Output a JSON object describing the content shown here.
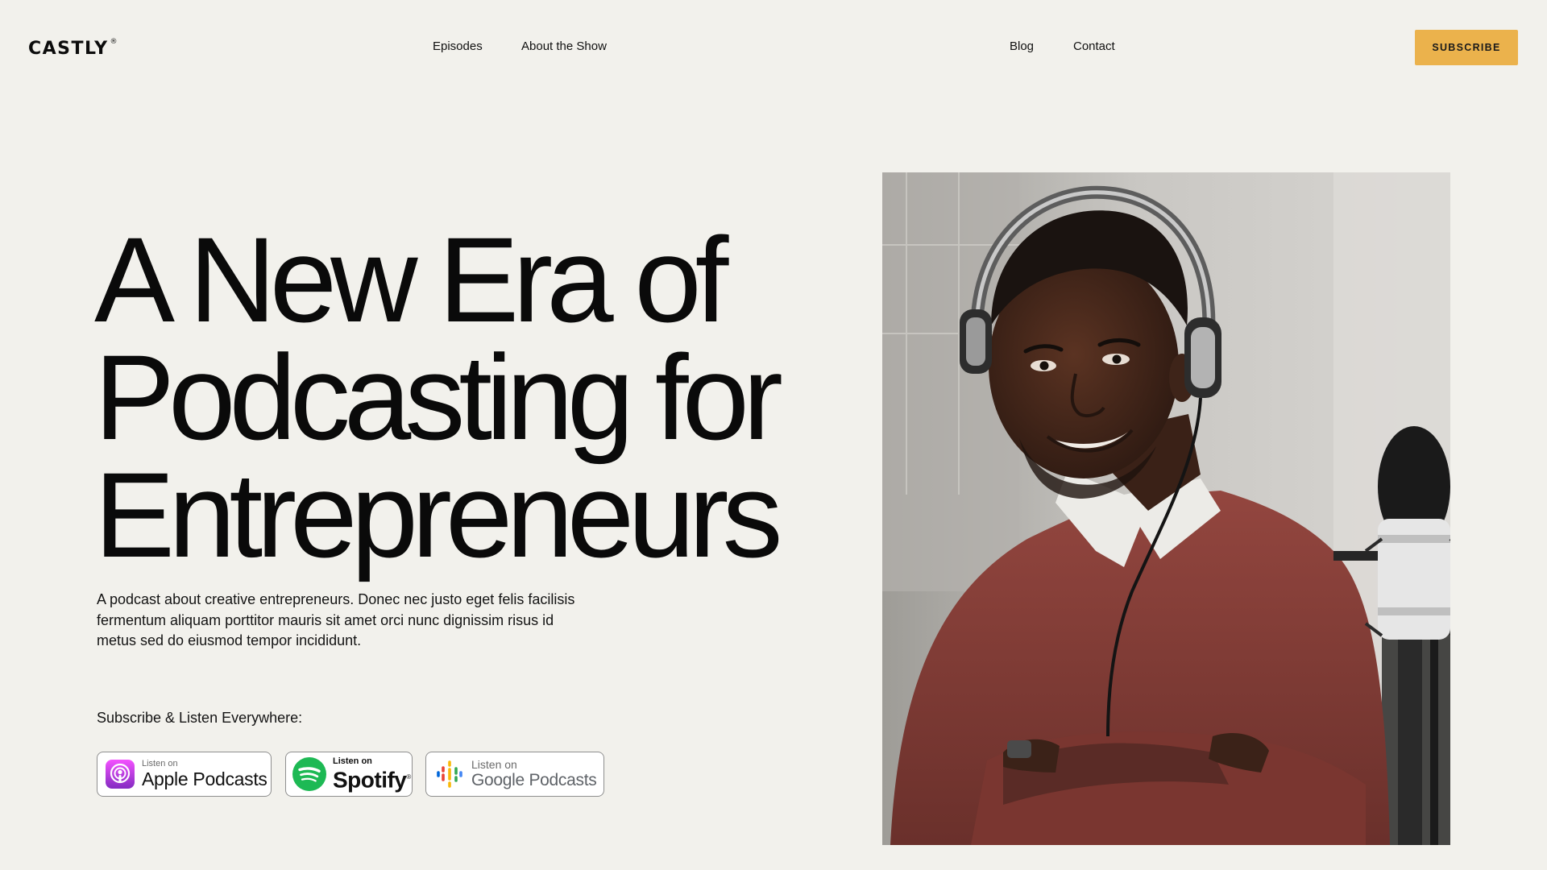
{
  "brand": {
    "name": "CASTLY",
    "mark": "®"
  },
  "nav": {
    "episodes": "Episodes",
    "about": "About the Show",
    "blog": "Blog",
    "contact": "Contact"
  },
  "header": {
    "subscribe_label": "SUBSCRIBE"
  },
  "hero": {
    "title_lines": [
      "A New Era of",
      "Podcasting for",
      "Entrepreneurs"
    ],
    "description": "A podcast about creative entrepreneurs. Donec nec justo eget felis facilisis fermentum aliquam porttitor mauris sit amet orci nunc dignissim risus id metus sed do eiusmod tempor incididunt.",
    "listen_label": "Subscribe & Listen Everywhere:"
  },
  "platforms": {
    "apple": {
      "small": "Listen on",
      "big": "Apple Podcasts",
      "icon": "apple-podcasts-icon"
    },
    "spotify": {
      "small": "Listen on",
      "big": "Spotify",
      "mark": "®",
      "icon": "spotify-icon"
    },
    "google": {
      "small": "Listen on",
      "big": "Google Podcasts",
      "icon": "google-podcasts-icon"
    }
  },
  "colors": {
    "background": "#f2f1ec",
    "accent": "#ebb24c",
    "text": "#0c0c0c",
    "apple_purple": "#9b3fd6",
    "spotify_green": "#1db954"
  }
}
